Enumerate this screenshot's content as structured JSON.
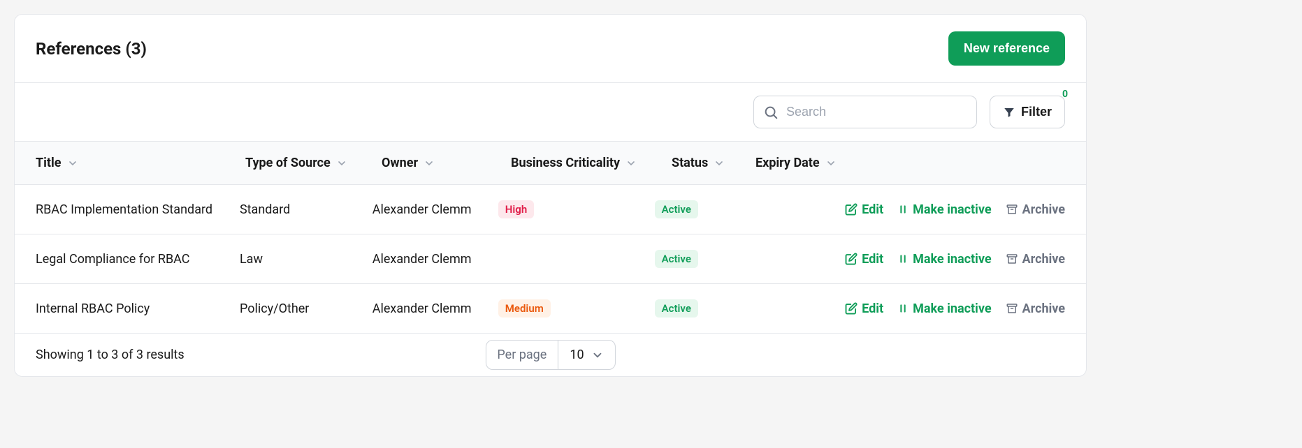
{
  "header": {
    "title": "References (3)",
    "new_button": "New reference"
  },
  "toolbar": {
    "search_placeholder": "Search",
    "filter_label": "Filter",
    "filter_count": "0"
  },
  "columns": {
    "title": "Title",
    "type": "Type of Source",
    "owner": "Owner",
    "criticality": "Business Criticality",
    "status": "Status",
    "expiry": "Expiry Date"
  },
  "rows": [
    {
      "title": "RBAC Implementation Standard",
      "type": "Standard",
      "owner": "Alexander Clemm",
      "criticality": "High",
      "criticality_class": "badge-high",
      "status": "Active",
      "expiry": ""
    },
    {
      "title": "Legal Compliance for RBAC",
      "type": "Law",
      "owner": "Alexander Clemm",
      "criticality": "",
      "criticality_class": "",
      "status": "Active",
      "expiry": ""
    },
    {
      "title": "Internal RBAC Policy",
      "type": "Policy/Other",
      "owner": "Alexander Clemm",
      "criticality": "Medium",
      "criticality_class": "badge-medium",
      "status": "Active",
      "expiry": ""
    }
  ],
  "actions": {
    "edit": "Edit",
    "make_inactive": "Make inactive",
    "archive": "Archive"
  },
  "footer": {
    "summary": "Showing 1 to 3 of 3 results",
    "per_page_label": "Per page",
    "per_page_value": "10"
  }
}
